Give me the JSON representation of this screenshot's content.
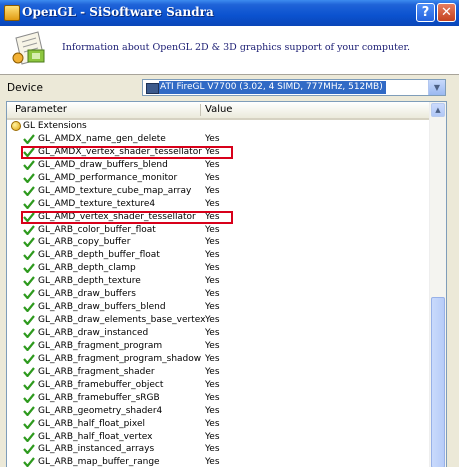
{
  "window": {
    "title": "OpenGL - SiSoftware Sandra",
    "help_label": "?",
    "close_label": "✕"
  },
  "header": {
    "description": "Information about OpenGL 2D & 3D graphics support of your computer.",
    "icon": "opengl-paper-icon"
  },
  "device": {
    "label": "Device",
    "value": "ATI FireGL V7700 (3.02, 4 SIMD, 777MHz, 512MB)",
    "icon": "monitor-icon"
  },
  "list": {
    "columns": {
      "parameter": "Parameter",
      "value": "Value"
    },
    "group": "GL Extensions",
    "items": [
      {
        "name": "GL_AMDX_name_gen_delete",
        "value": "Yes",
        "highlighted": false
      },
      {
        "name": "GL_AMDX_vertex_shader_tessellator",
        "value": "Yes",
        "highlighted": true
      },
      {
        "name": "GL_AMD_draw_buffers_blend",
        "value": "Yes",
        "highlighted": false
      },
      {
        "name": "GL_AMD_performance_monitor",
        "value": "Yes",
        "highlighted": false
      },
      {
        "name": "GL_AMD_texture_cube_map_array",
        "value": "Yes",
        "highlighted": false
      },
      {
        "name": "GL_AMD_texture_texture4",
        "value": "Yes",
        "highlighted": false
      },
      {
        "name": "GL_AMD_vertex_shader_tessellator",
        "value": "Yes",
        "highlighted": true
      },
      {
        "name": "GL_ARB_color_buffer_float",
        "value": "Yes",
        "highlighted": false
      },
      {
        "name": "GL_ARB_copy_buffer",
        "value": "Yes",
        "highlighted": false
      },
      {
        "name": "GL_ARB_depth_buffer_float",
        "value": "Yes",
        "highlighted": false
      },
      {
        "name": "GL_ARB_depth_clamp",
        "value": "Yes",
        "highlighted": false
      },
      {
        "name": "GL_ARB_depth_texture",
        "value": "Yes",
        "highlighted": false
      },
      {
        "name": "GL_ARB_draw_buffers",
        "value": "Yes",
        "highlighted": false
      },
      {
        "name": "GL_ARB_draw_buffers_blend",
        "value": "Yes",
        "highlighted": false
      },
      {
        "name": "GL_ARB_draw_elements_base_vertex",
        "value": "Yes",
        "highlighted": false
      },
      {
        "name": "GL_ARB_draw_instanced",
        "value": "Yes",
        "highlighted": false
      },
      {
        "name": "GL_ARB_fragment_program",
        "value": "Yes",
        "highlighted": false
      },
      {
        "name": "GL_ARB_fragment_program_shadow",
        "value": "Yes",
        "highlighted": false
      },
      {
        "name": "GL_ARB_fragment_shader",
        "value": "Yes",
        "highlighted": false
      },
      {
        "name": "GL_ARB_framebuffer_object",
        "value": "Yes",
        "highlighted": false
      },
      {
        "name": "GL_ARB_framebuffer_sRGB",
        "value": "Yes",
        "highlighted": false
      },
      {
        "name": "GL_ARB_geometry_shader4",
        "value": "Yes",
        "highlighted": false
      },
      {
        "name": "GL_ARB_half_float_pixel",
        "value": "Yes",
        "highlighted": false
      },
      {
        "name": "GL_ARB_half_float_vertex",
        "value": "Yes",
        "highlighted": false
      },
      {
        "name": "GL_ARB_instanced_arrays",
        "value": "Yes",
        "highlighted": false
      },
      {
        "name": "GL_ARB_map_buffer_range",
        "value": "Yes",
        "highlighted": false
      }
    ]
  },
  "colors": {
    "highlight_border": "#d8001a",
    "selection": "#316ac5",
    "titlebar": "#0b52cf"
  }
}
